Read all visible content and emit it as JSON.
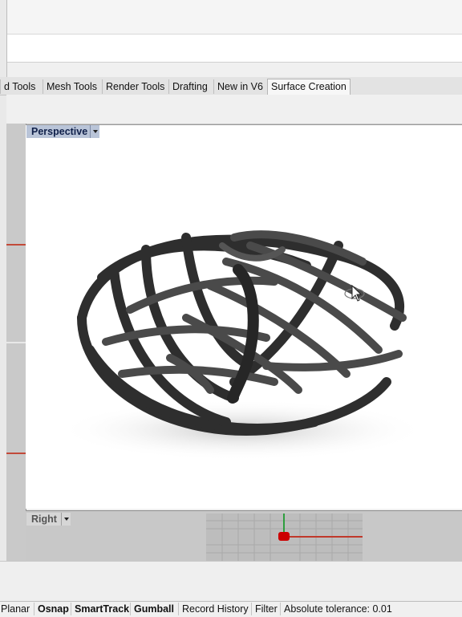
{
  "tabs": [
    {
      "label": "d Tools"
    },
    {
      "label": "Mesh Tools"
    },
    {
      "label": "Render Tools"
    },
    {
      "label": "Drafting"
    },
    {
      "label": "New in V6"
    },
    {
      "label": "Surface Creation"
    }
  ],
  "active_tab": "Surface Creation",
  "viewports": {
    "perspective": {
      "label": "Perspective"
    },
    "right": {
      "label": "Right"
    }
  },
  "statusbar": {
    "planar": "Planar",
    "osnap": "Osnap",
    "smarttrack": "SmartTrack",
    "gumball": "Gumball",
    "record_history": "Record History",
    "filter": "Filter",
    "tolerance": "Absolute tolerance: 0.01"
  },
  "colors": {
    "active_viewport_label": "#b9c4d8",
    "model": "#3a3a3a",
    "x_axis": "#c0392b",
    "y_axis": "#2e9e3e",
    "point": "#cc0000"
  },
  "icons": [
    "viewport-menu-arrow-icon",
    "rotate-cursor-icon"
  ]
}
